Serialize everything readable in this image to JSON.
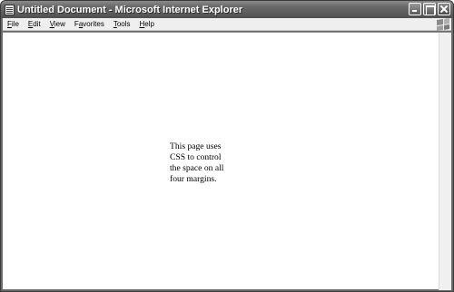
{
  "window": {
    "title": "Untitled Document - Microsoft Internet Explorer",
    "icon": "ie-document-icon"
  },
  "menu": [
    {
      "label": "File",
      "accesskey": "F",
      "rest": "ile"
    },
    {
      "label": "Edit",
      "accesskey": "E",
      "rest": "dit"
    },
    {
      "label": "View",
      "accesskey": "V",
      "rest": "iew"
    },
    {
      "label": "Favorites",
      "accesskey": "a",
      "pre": "F",
      "rest": "vorites"
    },
    {
      "label": "Tools",
      "accesskey": "T",
      "rest": "ools"
    },
    {
      "label": "Help",
      "accesskey": "H",
      "rest": "elp"
    }
  ],
  "content": {
    "text": "This page uses CSS to control the space on all four margins."
  }
}
